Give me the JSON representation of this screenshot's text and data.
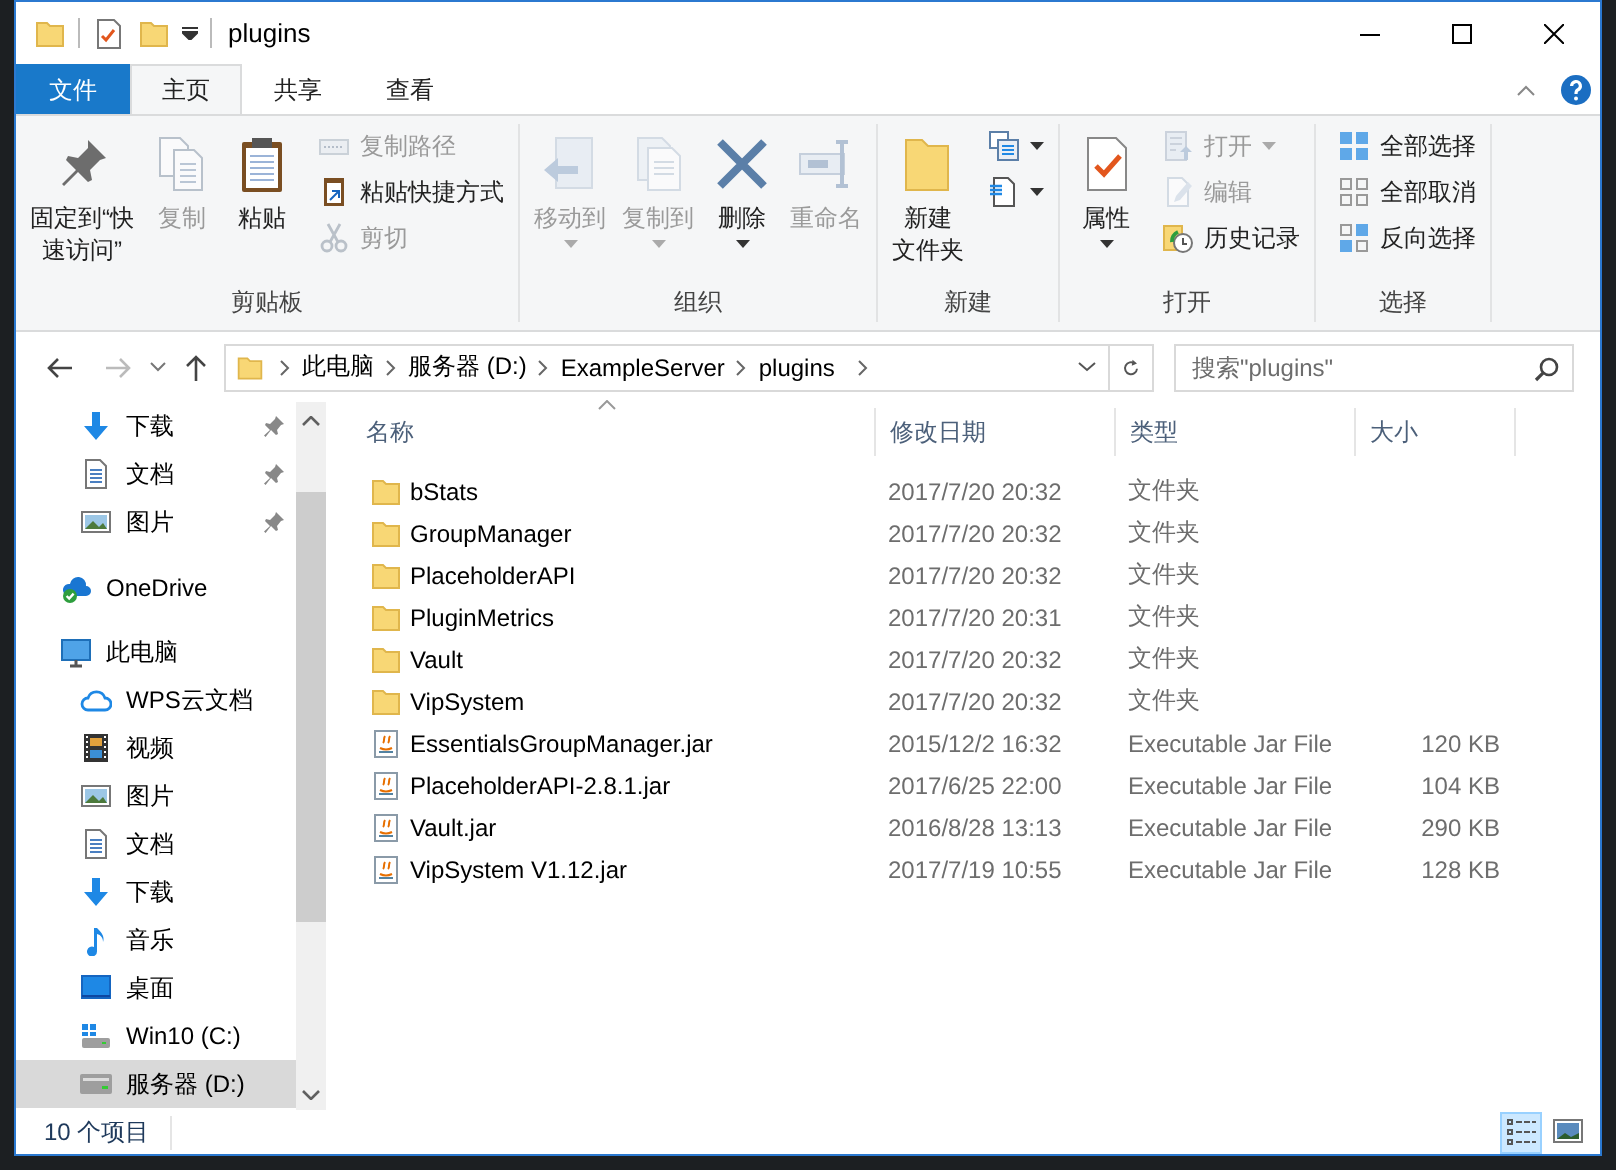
{
  "window": {
    "title": "plugins"
  },
  "ribbon": {
    "tabs": [
      {
        "label": "文件",
        "kind": "file",
        "selected": false
      },
      {
        "label": "主页",
        "kind": "tab",
        "selected": true
      },
      {
        "label": "共享",
        "kind": "tab",
        "selected": false
      },
      {
        "label": "查看",
        "kind": "tab",
        "selected": false
      }
    ],
    "groups": [
      {
        "label": "剪贴板",
        "large": [
          {
            "kind": "pin",
            "label": [
              "固定到“快",
              "速访问”"
            ],
            "disabled": false,
            "dropdown": false
          },
          {
            "kind": "copy",
            "label": "复制",
            "disabled": true,
            "dropdown": false
          },
          {
            "kind": "paste",
            "label": "粘贴",
            "disabled": false,
            "dropdown": false
          }
        ],
        "small": [
          {
            "kind": "copy-path",
            "label": "复制路径",
            "disabled": true,
            "dropdown": false
          },
          {
            "kind": "paste-shortcut",
            "label": "粘贴快捷方式",
            "disabled": false,
            "dropdown": false
          },
          {
            "kind": "cut",
            "label": "剪切",
            "disabled": true,
            "dropdown": false
          }
        ]
      },
      {
        "label": "组织",
        "large": [
          {
            "kind": "move-to",
            "label": "移动到",
            "disabled": true,
            "dropdown": true
          },
          {
            "kind": "copy-to",
            "label": "复制到",
            "disabled": true,
            "dropdown": true
          },
          {
            "kind": "delete",
            "label": "删除",
            "disabled": false,
            "dropdown": true
          },
          {
            "kind": "rename",
            "label": "重命名",
            "disabled": true,
            "dropdown": false
          }
        ]
      },
      {
        "label": "新建",
        "large": [
          {
            "kind": "new-folder",
            "label": [
              "新建",
              "文件夹"
            ],
            "disabled": false,
            "dropdown": false
          }
        ],
        "small": [
          {
            "kind": "new-item",
            "disabled": false,
            "dropdown": true
          },
          {
            "kind": "easy-access",
            "disabled": false,
            "dropdown": true
          }
        ]
      },
      {
        "label": "打开",
        "large": [
          {
            "kind": "properties",
            "label": "属性",
            "disabled": false,
            "dropdown": true
          }
        ],
        "small": [
          {
            "kind": "open",
            "label": "打开",
            "disabled": true,
            "dropdown": true
          },
          {
            "kind": "edit",
            "label": "编辑",
            "disabled": true,
            "dropdown": false
          },
          {
            "kind": "history",
            "label": "历史记录",
            "disabled": false,
            "dropdown": false
          }
        ]
      },
      {
        "label": "选择",
        "small": [
          {
            "kind": "select-all",
            "label": "全部选择",
            "disabled": false,
            "dropdown": false
          },
          {
            "kind": "select-none",
            "label": "全部取消",
            "disabled": false,
            "dropdown": false
          },
          {
            "kind": "invert-selection",
            "label": "反向选择",
            "disabled": false,
            "dropdown": false
          }
        ]
      }
    ]
  },
  "address": {
    "breadcrumbs": [
      "此电脑",
      "服务器 (D:)",
      "ExampleServer",
      "plugins"
    ],
    "search_placeholder": "搜索\"plugins\""
  },
  "nav": {
    "pinned_items": [
      {
        "label": "下载",
        "kind": "download",
        "pinned": true
      },
      {
        "label": "文档",
        "kind": "document",
        "pinned": true
      },
      {
        "label": "图片",
        "kind": "pictures",
        "pinned": true
      }
    ],
    "items": [
      {
        "label": "OneDrive",
        "kind": "onedrive",
        "selected": false
      },
      {
        "label": "此电脑",
        "kind": "pc",
        "selected": false,
        "children": [
          {
            "label": "WPS云文档",
            "kind": "cloud",
            "selected": false
          },
          {
            "label": "视频",
            "kind": "video",
            "selected": false
          },
          {
            "label": "图片",
            "kind": "pictures",
            "selected": false
          },
          {
            "label": "文档",
            "kind": "document",
            "selected": false
          },
          {
            "label": "下载",
            "kind": "download",
            "selected": false
          },
          {
            "label": "音乐",
            "kind": "music",
            "selected": false
          },
          {
            "label": "桌面",
            "kind": "desktop",
            "selected": false
          },
          {
            "label": "Win10 (C:)",
            "kind": "system-drive",
            "selected": false
          },
          {
            "label": "服务器 (D:)",
            "kind": "drive",
            "selected": true
          }
        ]
      }
    ]
  },
  "file_list": {
    "columns": [
      {
        "label": "名称",
        "sorted": true
      },
      {
        "label": "修改日期",
        "sorted": false
      },
      {
        "label": "类型",
        "sorted": false
      },
      {
        "label": "大小",
        "sorted": false
      }
    ],
    "files": [
      {
        "name": "bStats",
        "modified": "2017/7/20 20:32",
        "type": "文件夹",
        "kind": "folder"
      },
      {
        "name": "GroupManager",
        "modified": "2017/7/20 20:32",
        "type": "文件夹",
        "kind": "folder"
      },
      {
        "name": "PlaceholderAPI",
        "modified": "2017/7/20 20:32",
        "type": "文件夹",
        "kind": "folder"
      },
      {
        "name": "PluginMetrics",
        "modified": "2017/7/20 20:31",
        "type": "文件夹",
        "kind": "folder"
      },
      {
        "name": "Vault",
        "modified": "2017/7/20 20:32",
        "type": "文件夹",
        "kind": "folder"
      },
      {
        "name": "VipSystem",
        "modified": "2017/7/20 20:32",
        "type": "文件夹",
        "kind": "folder"
      },
      {
        "name": "EssentialsGroupManager.jar",
        "modified": "2015/12/2 16:32",
        "type": "Executable Jar File",
        "size": "120 KB",
        "kind": "jar"
      },
      {
        "name": "PlaceholderAPI-2.8.1.jar",
        "modified": "2017/6/25 22:00",
        "type": "Executable Jar File",
        "size": "104 KB",
        "kind": "jar"
      },
      {
        "name": "Vault.jar",
        "modified": "2016/8/28 13:13",
        "type": "Executable Jar File",
        "size": "290 KB",
        "kind": "jar"
      },
      {
        "name": "VipSystem V1.12.jar",
        "modified": "2017/7/19 10:55",
        "type": "Executable Jar File",
        "size": "128 KB",
        "kind": "jar"
      }
    ]
  },
  "status_bar": {
    "item_count": "10 个项目",
    "views": [
      {
        "kind": "details",
        "selected": true
      },
      {
        "kind": "large-icons",
        "selected": false
      }
    ]
  }
}
